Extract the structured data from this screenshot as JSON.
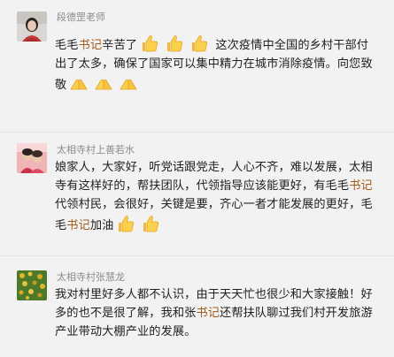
{
  "comments": [
    {
      "name": "段德罡老师",
      "parts": {
        "p1": "毛毛",
        "p2": "书记",
        "p3": "辛苦了",
        "p4": " 这次疫情中全国的乡村干部付出了太多，确保了国家可以集中精力在城市消除疫情。向您致敬"
      }
    },
    {
      "name": "太相寺村上善若水",
      "parts": {
        "p1": "娘家人，大家好，听党话跟党走，人心不齐，难以发展，太相寺有这样好的，帮扶团队，代领指导应该能更好，有毛毛",
        "p2": "书记",
        "p3": "代领村民，会很好，关键是要，齐心一者才能发展的更好，毛毛",
        "p4": "书记",
        "p5": "加油"
      }
    },
    {
      "name": "太相寺村张慧龙",
      "parts": {
        "p1": "我对村里好多人都不认识，由于天天忙也很少和大家接触！好多的也不是很了解，我和张",
        "p2": "书记",
        "p3": "还帮扶队聊过我们村开发旅游产业带动大棚产业的发展。"
      }
    }
  ],
  "colors": {
    "background": "#f2f2f2",
    "highlight": "#a35d1a",
    "name": "#8a8a8a"
  }
}
